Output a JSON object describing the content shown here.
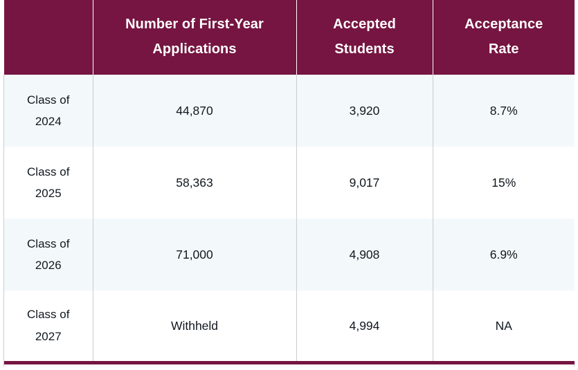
{
  "table": {
    "name": "first-year-admissions-statistics",
    "colors": {
      "header_background": "#761541",
      "header_text": "#ffffff",
      "row_tint_background": "#f3f8fb",
      "row_plain_background": "#ffffff",
      "body_text": "#11181f",
      "grid_line": "#c9ccd2",
      "bottom_rule": "#761541"
    },
    "headers": [
      {
        "line1": "",
        "line2": ""
      },
      {
        "line1": "Number of First-Year",
        "line2": "Applications"
      },
      {
        "line1": "Accepted",
        "line2": "Students"
      },
      {
        "line1": "Acceptance",
        "line2": "Rate"
      }
    ],
    "rows": [
      {
        "label_line1": "Class of",
        "label_line2": "2024",
        "applications": "44,870",
        "accepted_students": "3,920",
        "acceptance_rate": "8.7%"
      },
      {
        "label_line1": "Class of",
        "label_line2": "2025",
        "applications": "58,363",
        "accepted_students": "9,017",
        "acceptance_rate": "15%"
      },
      {
        "label_line1": "Class of",
        "label_line2": "2026",
        "applications": "71,000",
        "accepted_students": "4,908",
        "acceptance_rate": "6.9%"
      },
      {
        "label_line1": "Class of",
        "label_line2": "2027",
        "applications": "Withheld",
        "accepted_students": "4,994",
        "acceptance_rate": "NA"
      }
    ]
  },
  "chart_data": {
    "type": "table",
    "title": "",
    "columns": [
      "",
      "Number of First-Year Applications",
      "Accepted Students",
      "Acceptance Rate"
    ],
    "rows": [
      [
        "Class of 2024",
        "44,870",
        "3,920",
        "8.7%"
      ],
      [
        "Class of 2025",
        "58,363",
        "9,017",
        "15%"
      ],
      [
        "Class of 2026",
        "71,000",
        "4,908",
        "6.9%"
      ],
      [
        "Class of 2027",
        "Withheld",
        "4,994",
        "NA"
      ]
    ]
  }
}
